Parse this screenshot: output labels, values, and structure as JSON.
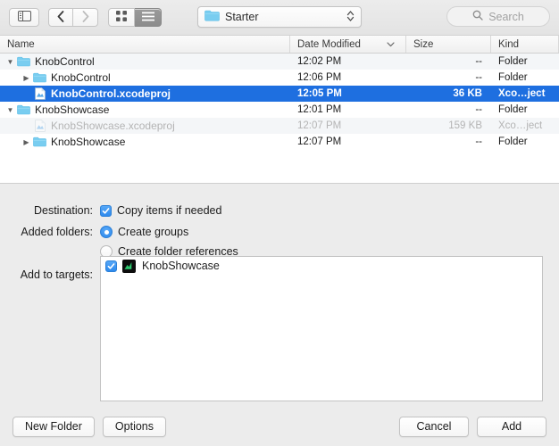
{
  "toolbar": {
    "sidebar_toggle_icon": "sidebar-icon",
    "back_icon": "chevron-left-icon",
    "forward_icon": "chevron-right-icon",
    "icon_view_icon": "grid-view-icon",
    "list_view_icon": "list-view-icon",
    "path_popup": {
      "label": "Starter",
      "folder_icon": "folder-icon",
      "stepper_icon": "updown-chevron-icon"
    },
    "search": {
      "placeholder": "Search",
      "icon": "search-icon"
    }
  },
  "columns": {
    "name": "Name",
    "date_modified": "Date Modified",
    "size": "Size",
    "kind": "Kind",
    "sort_icon": "chevron-down-icon"
  },
  "files": [
    {
      "name": "KnobControl",
      "date": "12:02 PM",
      "size": "--",
      "kind": "Folder",
      "depth": 0,
      "icon": "folder-icon",
      "disclosure": "▼",
      "selected": false,
      "dimmed": false
    },
    {
      "name": "KnobControl",
      "date": "12:06 PM",
      "size": "--",
      "kind": "Folder",
      "depth": 1,
      "icon": "folder-icon",
      "disclosure": "▶",
      "selected": false,
      "dimmed": false
    },
    {
      "name": "KnobControl.xcodeproj",
      "date": "12:05 PM",
      "size": "36 KB",
      "kind": "Xco…ject",
      "depth": 1,
      "icon": "xcodeproj-icon",
      "disclosure": "",
      "selected": true,
      "dimmed": false
    },
    {
      "name": "KnobShowcase",
      "date": "12:01 PM",
      "size": "--",
      "kind": "Folder",
      "depth": 0,
      "icon": "folder-icon",
      "disclosure": "▼",
      "selected": false,
      "dimmed": false
    },
    {
      "name": "KnobShowcase.xcodeproj",
      "date": "12:07 PM",
      "size": "159 KB",
      "kind": "Xco…ject",
      "depth": 1,
      "icon": "xcodeproj-icon",
      "disclosure": "",
      "selected": false,
      "dimmed": true
    },
    {
      "name": "KnobShowcase",
      "date": "12:07 PM",
      "size": "--",
      "kind": "Folder",
      "depth": 1,
      "icon": "folder-icon",
      "disclosure": "▶",
      "selected": false,
      "dimmed": false
    }
  ],
  "options": {
    "destination_label": "Destination:",
    "copy_items_label": "Copy items if needed",
    "copy_items_checked": true,
    "added_folders_label": "Added folders:",
    "create_groups_label": "Create groups",
    "create_groups_selected": true,
    "create_folder_refs_label": "Create folder references",
    "create_folder_refs_selected": false,
    "add_to_targets_label": "Add to targets:",
    "targets": [
      {
        "name": "KnobShowcase",
        "checked": true,
        "icon": "xcode-target-icon"
      }
    ]
  },
  "buttons": {
    "new_folder": "New Folder",
    "options": "Options",
    "cancel": "Cancel",
    "add": "Add"
  },
  "colors": {
    "selection_blue": "#1e6fe0",
    "control_blue": "#2d8aee",
    "window_bg": "#ececec",
    "list_bg": "#ffffff",
    "alt_row": "#f4f6f8",
    "folder_blue": "#7fd3f4"
  }
}
